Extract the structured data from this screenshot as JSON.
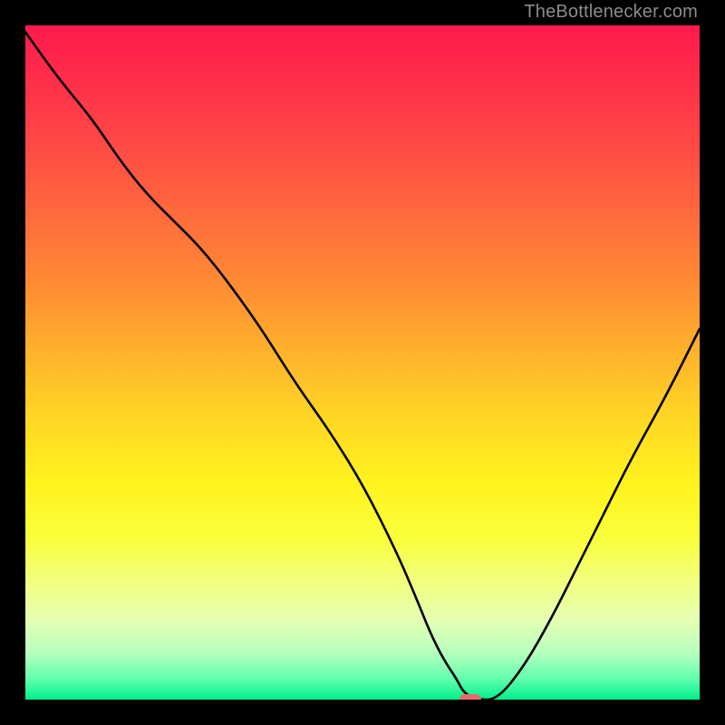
{
  "watermark": {
    "text": "TheBottlenecker.com"
  },
  "chart_data": {
    "type": "line",
    "title": "",
    "xlabel": "",
    "ylabel": "",
    "xlim": [
      0,
      100
    ],
    "ylim": [
      0,
      100
    ],
    "x": [
      0,
      5,
      10,
      14,
      18,
      22,
      26,
      30,
      35,
      40,
      45,
      50,
      55,
      58,
      60,
      62,
      64,
      65,
      67,
      70,
      74,
      78,
      82,
      86,
      90,
      95,
      100
    ],
    "values": [
      99,
      92,
      86,
      80,
      75,
      71,
      67,
      62,
      55,
      47,
      40,
      32,
      22,
      15,
      10,
      6,
      3,
      1,
      0,
      0,
      5,
      12,
      20,
      28,
      36,
      45,
      55
    ],
    "marker": {
      "x": 66,
      "y": 0,
      "color": "#e76a6a"
    },
    "gradient_stops": [
      {
        "pct": 0,
        "color": "#ff1a4d"
      },
      {
        "pct": 100,
        "color": "#00ef8a"
      }
    ]
  }
}
